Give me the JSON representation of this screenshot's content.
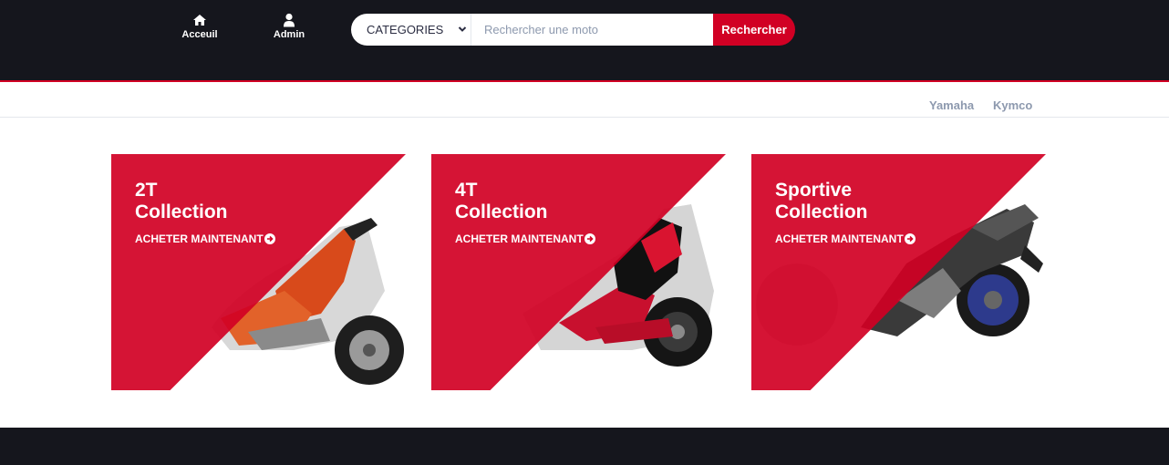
{
  "header": {
    "nav": [
      {
        "label": "Acceuil",
        "icon": "home-icon"
      },
      {
        "label": "Admin",
        "icon": "user-icon"
      }
    ],
    "search": {
      "category_selected": "CATEGORIES",
      "placeholder": "Rechercher une moto",
      "button_label": "Rechercher"
    }
  },
  "brands": [
    "Yamaha",
    "Kymco"
  ],
  "collections": [
    {
      "title_line1": "2T",
      "title_line2": "Collection",
      "cta": "ACHETER MAINTENANT"
    },
    {
      "title_line1": "4T",
      "title_line2": "Collection",
      "cta": "ACHETER MAINTENANT"
    },
    {
      "title_line1": "Sportive",
      "title_line2": "Collection",
      "cta": "ACHETER MAINTENANT"
    }
  ],
  "colors": {
    "primary": "#d10024",
    "dark": "#15161d",
    "muted": "#8d99ae"
  }
}
